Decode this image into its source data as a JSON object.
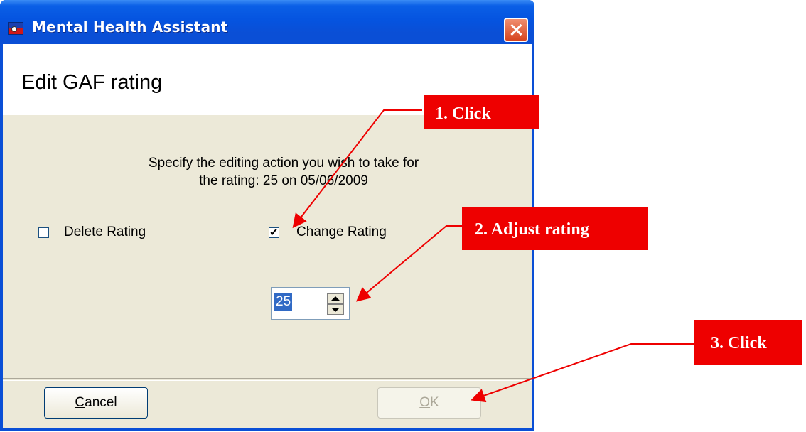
{
  "window": {
    "title": "Mental Health Assistant",
    "close_label": "Close"
  },
  "dialog": {
    "heading": "Edit GAF rating",
    "instruction_line1": "Specify the editing action you wish to take for",
    "instruction_line2": "the rating: 25 on 05/06/2009"
  },
  "options": {
    "delete_label": "Delete Rating",
    "delete_checked": false,
    "change_label": "Change Rating",
    "change_checked": true
  },
  "rating": {
    "value": "25"
  },
  "buttons": {
    "cancel_label": "Cancel",
    "ok_label": "OK",
    "ok_enabled": false
  },
  "annotations": {
    "step1": "1. Click",
    "step2": "2. Adjust rating",
    "step3": "3. Click",
    "color": "#ee0000"
  },
  "colors": {
    "titlebar": "#0554e0",
    "dialog_bg": "#ece9d8",
    "selection": "#316ac5"
  }
}
